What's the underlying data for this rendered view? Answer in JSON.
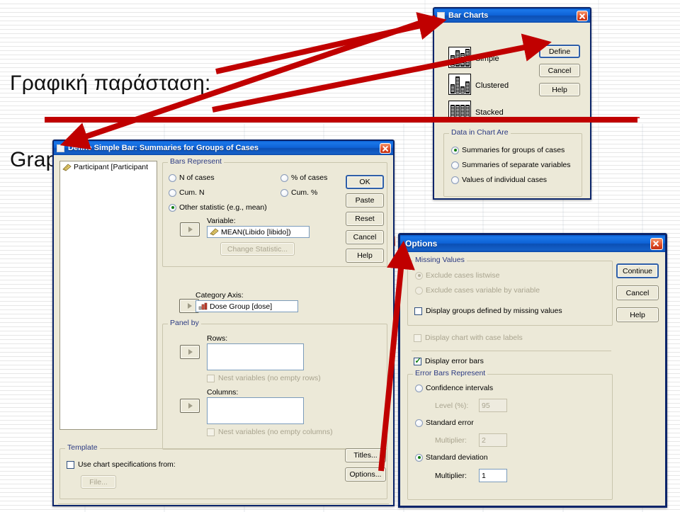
{
  "slide": {
    "title_line1": "Γραφική παράσταση:",
    "title_line2": "Graphs -> Bar"
  },
  "bar_charts_dialog": {
    "title": "Bar Charts",
    "close_icon": "close-icon",
    "chart_types": [
      {
        "label": "Simple",
        "icon": "simple-bar-icon"
      },
      {
        "label": "Clustered",
        "icon": "clustered-bar-icon"
      },
      {
        "label": "Stacked",
        "icon": "stacked-bar-icon"
      }
    ],
    "data_group": {
      "legend": "Data in Chart Are",
      "options": [
        {
          "label": "Summaries for groups of cases",
          "selected": true
        },
        {
          "label": "Summaries of separate variables",
          "selected": false
        },
        {
          "label": "Values of individual cases",
          "selected": false
        }
      ]
    },
    "buttons": [
      {
        "label": "Define",
        "default": true
      },
      {
        "label": "Cancel",
        "default": false
      },
      {
        "label": "Help",
        "default": false
      }
    ]
  },
  "define_dialog": {
    "title": "Define Simple Bar: Summaries for Groups of Cases",
    "close_icon": "close-icon",
    "variable_list": [
      {
        "label": "Participant [Participant",
        "icon": "ruler-variable-icon"
      }
    ],
    "bars_represent": {
      "legend": "Bars Represent",
      "options": [
        {
          "label": "N of cases",
          "selected": false
        },
        {
          "label": "% of cases",
          "selected": false
        },
        {
          "label": "Cum. N",
          "selected": false
        },
        {
          "label": "Cum. %",
          "selected": false
        },
        {
          "label": "Other statistic (e.g., mean)",
          "selected": true
        }
      ],
      "variable_label": "Variable:",
      "variable_value": "MEAN(Libido [libido])",
      "variable_icon": "ruler-variable-icon",
      "change_statistic_button": "Change Statistic...",
      "move_button_icon": "move-right-arrow-icon"
    },
    "category_axis": {
      "label": "Category Axis:",
      "value": "Dose Group [dose]",
      "value_icon": "bar-chart-variable-icon",
      "move_button_icon": "move-right-arrow-icon"
    },
    "panel_by": {
      "legend": "Panel by",
      "rows_label": "Rows:",
      "rows_value": "",
      "rows_nest_label": "Nest variables (no empty rows)",
      "rows_nest_checked": false,
      "columns_label": "Columns:",
      "columns_value": "",
      "columns_nest_label": "Nest variables (no empty columns)",
      "columns_nest_checked": false,
      "move_button_icon": "move-right-arrow-icon"
    },
    "template": {
      "legend": "Template",
      "use_spec_label": "Use chart specifications from:",
      "use_spec_checked": false,
      "file_button": "File..."
    },
    "buttons": [
      {
        "label": "OK",
        "default": true
      },
      {
        "label": "Paste",
        "default": false
      },
      {
        "label": "Reset",
        "default": false
      },
      {
        "label": "Cancel",
        "default": false
      },
      {
        "label": "Help",
        "default": false
      }
    ],
    "bottom_buttons": [
      {
        "label": "Titles..."
      },
      {
        "label": "Options..."
      }
    ]
  },
  "options_dialog": {
    "title": "Options",
    "close_icon": "close-icon",
    "missing_values": {
      "legend": "Missing Values",
      "options": [
        {
          "label": "Exclude cases listwise",
          "selected": true,
          "disabled": true
        },
        {
          "label": "Exclude cases variable by variable",
          "selected": false,
          "disabled": true
        }
      ],
      "display_groups_label": "Display groups defined by missing values",
      "display_groups_checked": false
    },
    "display_chart_labels": {
      "label": "Display chart with case labels",
      "checked": false,
      "disabled": true
    },
    "display_error_bars": {
      "label": "Display error bars",
      "checked": true
    },
    "error_bars_represent": {
      "legend": "Error Bars Represent",
      "options": [
        {
          "label": "Confidence intervals",
          "selected": false,
          "sub_label": "Level (%):",
          "sub_value": "95",
          "sub_disabled": true
        },
        {
          "label": "Standard error",
          "selected": false,
          "sub_label": "Multiplier:",
          "sub_value": "2",
          "sub_disabled": true
        },
        {
          "label": "Standard deviation",
          "selected": true,
          "sub_label": "Multiplier:",
          "sub_value": "1",
          "sub_disabled": false
        }
      ]
    },
    "buttons": [
      {
        "label": "Continue",
        "default": true
      },
      {
        "label": "Cancel",
        "default": false
      },
      {
        "label": "Help",
        "default": false
      }
    ]
  },
  "annotations": {
    "accent_color": "#c00000",
    "arrow_to_bar_charts": "points from Graphs -> Bar text to Bar Charts dialog title",
    "arrow_to_define_button": "points to Define button",
    "arrow_to_define_dialog": "points to Define Simple Bar dialog title",
    "arrow_to_options_dialog": "points from Options... button to Options dialog"
  }
}
